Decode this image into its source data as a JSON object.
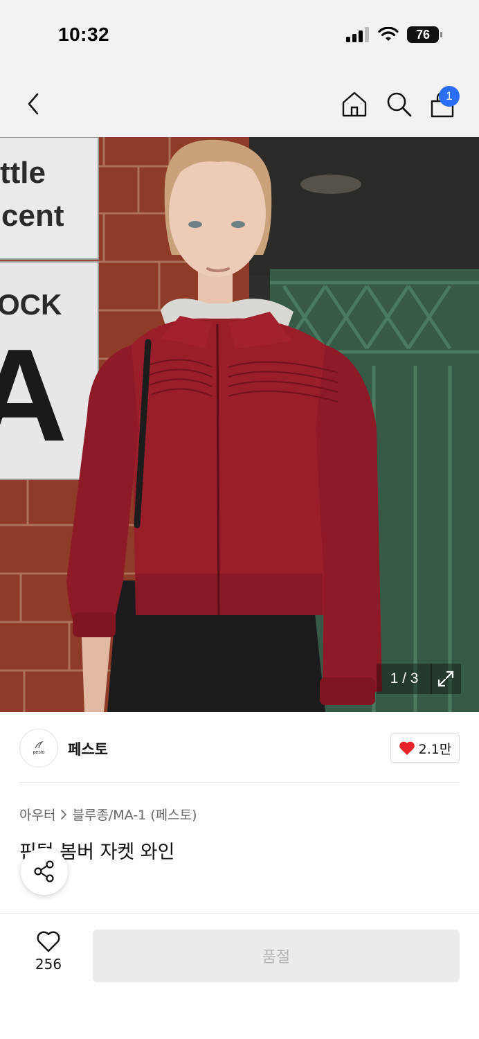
{
  "status_bar": {
    "time": "10:32",
    "battery": "76"
  },
  "header": {
    "cart_count": "1"
  },
  "image": {
    "counter": "1 / 3",
    "sign_line1": "ttle",
    "sign_line2": "cent",
    "sign_line3": "OCK",
    "sign_letter": "A"
  },
  "brand": {
    "name": "페스토",
    "logo_text": "pesto",
    "like_count": "2.1만"
  },
  "product": {
    "breadcrumb_parent": "아우터",
    "breadcrumb_child": "블루종/MA-1 (페스토)",
    "title": "핀턱 봄버 자켓 와인"
  },
  "footer": {
    "wish_count": "256",
    "buy_label": "품절"
  },
  "colors": {
    "accent_badge": "#2b6ef5",
    "heart": "#e8222a",
    "jacket": "#9a1d2a"
  }
}
